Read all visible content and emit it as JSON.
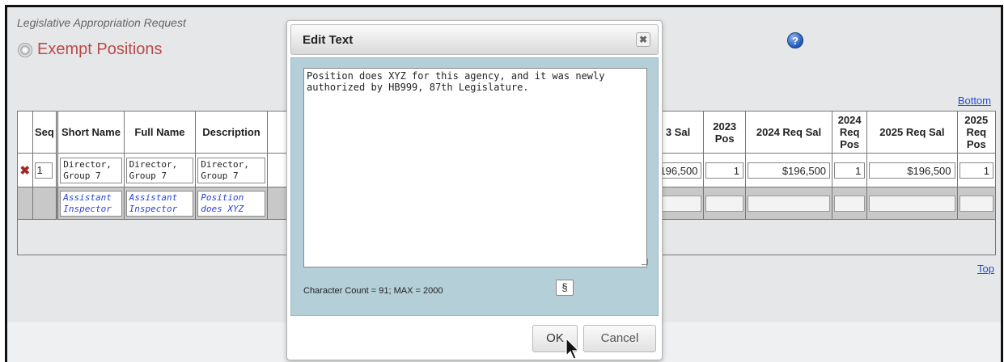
{
  "header": {
    "app_subtitle": "Legislative Appropriation Request",
    "section_title": "Exempt Positions"
  },
  "links": {
    "bottom": "Bottom",
    "top": "Top"
  },
  "table": {
    "columns": [
      "Seq",
      "Short Name",
      "Full Name",
      "Description",
      "3 Sal",
      "2023 Pos",
      "2024 Req Sal",
      "2024 Req Pos",
      "2025 Req Sal",
      "2025 Req Pos"
    ],
    "row1": {
      "seq": "1",
      "short_name": "Director, Group 7",
      "full_name": "Director, Group 7",
      "description": "Director, Group 7",
      "sal_2023": "196,500",
      "pos_2023": "1",
      "req_sal_2024": "$196,500",
      "req_pos_2024": "1",
      "req_sal_2025": "$196,500",
      "req_pos_2025": "1"
    },
    "row2": {
      "short_name": "Assistant Inspector",
      "full_name": "Assistant Inspector",
      "description": "Position does XYZ"
    }
  },
  "dialog": {
    "title": "Edit Text",
    "close_glyph": "✖",
    "text": "Position does XYZ for this agency, and it was newly\nauthorized by HB999, 87th Legislature.",
    "char_count": "Character Count = 91; MAX = 2000",
    "section_glyph": "§",
    "ok_label": "OK",
    "cancel_label": "Cancel"
  },
  "icons": {
    "delete": "delete-x-icon",
    "help": "help-icon",
    "section": "gear-section-icon",
    "cursor": "mouse-pointer-icon"
  },
  "colors": {
    "section_title": "#b94a48",
    "link": "#1f4fd6",
    "dialog_body": "#b4cfd8",
    "italic_text": "#2a44d4"
  }
}
